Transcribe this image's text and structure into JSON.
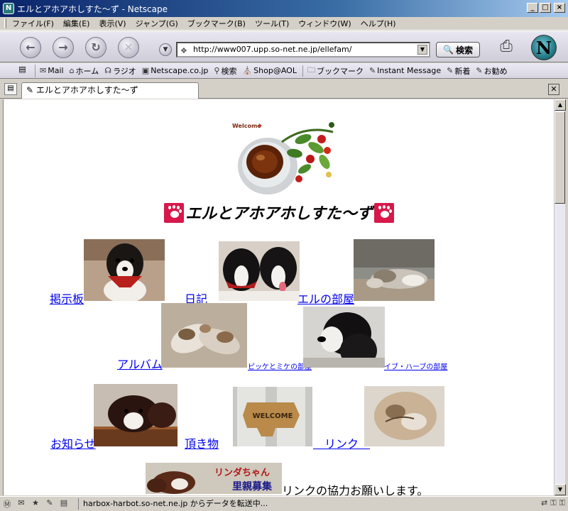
{
  "window": {
    "title": "エルとアホアホしすた～ず - Netscape",
    "app_icon": "N"
  },
  "menu": {
    "items": [
      "ファイル(F)",
      "編集(E)",
      "表示(V)",
      "ジャンプ(G)",
      "ブックマーク(B)",
      "ツール(T)",
      "ウィンドウ(W)",
      "ヘルプ(H)"
    ]
  },
  "navbar": {
    "back_icon": "back-arrow-icon",
    "forward_icon": "forward-arrow-icon",
    "reload_icon": "reload-icon",
    "stop_icon": "stop-icon",
    "url": "http://www007.upp.so-net.ne.jp/ellefam/",
    "search_label": "検索",
    "logo_letter": "N"
  },
  "personal_toolbar": {
    "items": [
      {
        "icon": "mail-icon",
        "label": "Mail"
      },
      {
        "icon": "home-icon",
        "label": "ホーム"
      },
      {
        "icon": "radio-icon",
        "label": "ラジオ"
      },
      {
        "icon": "my-netscape-icon",
        "label": "Netscape.co.jp"
      },
      {
        "icon": "search-icon",
        "label": "検索"
      },
      {
        "icon": "shop-icon",
        "label": "Shop@AOL"
      },
      {
        "icon": "bookmark-icon",
        "label": "ブックマーク"
      },
      {
        "icon": "bookmark-icon",
        "label": "Instant Message"
      },
      {
        "icon": "bookmark-icon",
        "label": "新着"
      },
      {
        "icon": "bookmark-icon",
        "label": "お勧め"
      }
    ]
  },
  "tab": {
    "label": "エルとアホアホしすた～ず"
  },
  "page": {
    "welcome_text": "Welcome",
    "title": "エルとアホアホしすた～ず",
    "links": {
      "bbs": "掲示板",
      "diary": "　日記　",
      "elle_room": "エルの部屋",
      "album": "アルバム",
      "pikke_mike": "ピッケとミケの部屋",
      "ibu_herb": "イブ・ハーブの部屋",
      "news": "お知らせ",
      "gifts": "頂き物",
      "link": "　リンク　"
    },
    "banner_text_1": "リンダちゃん",
    "banner_text_2": "里親募集",
    "welcome_sign": "WELCOME",
    "link_request": "リンクの協力お願いします。"
  },
  "statusbar": {
    "text": "harbox-harbot.so-net.ne.jp からデータを転送中..."
  },
  "colors": {
    "link": "#0000ee",
    "title_bar": "#0a246a",
    "paw_red": "#d8174a"
  }
}
